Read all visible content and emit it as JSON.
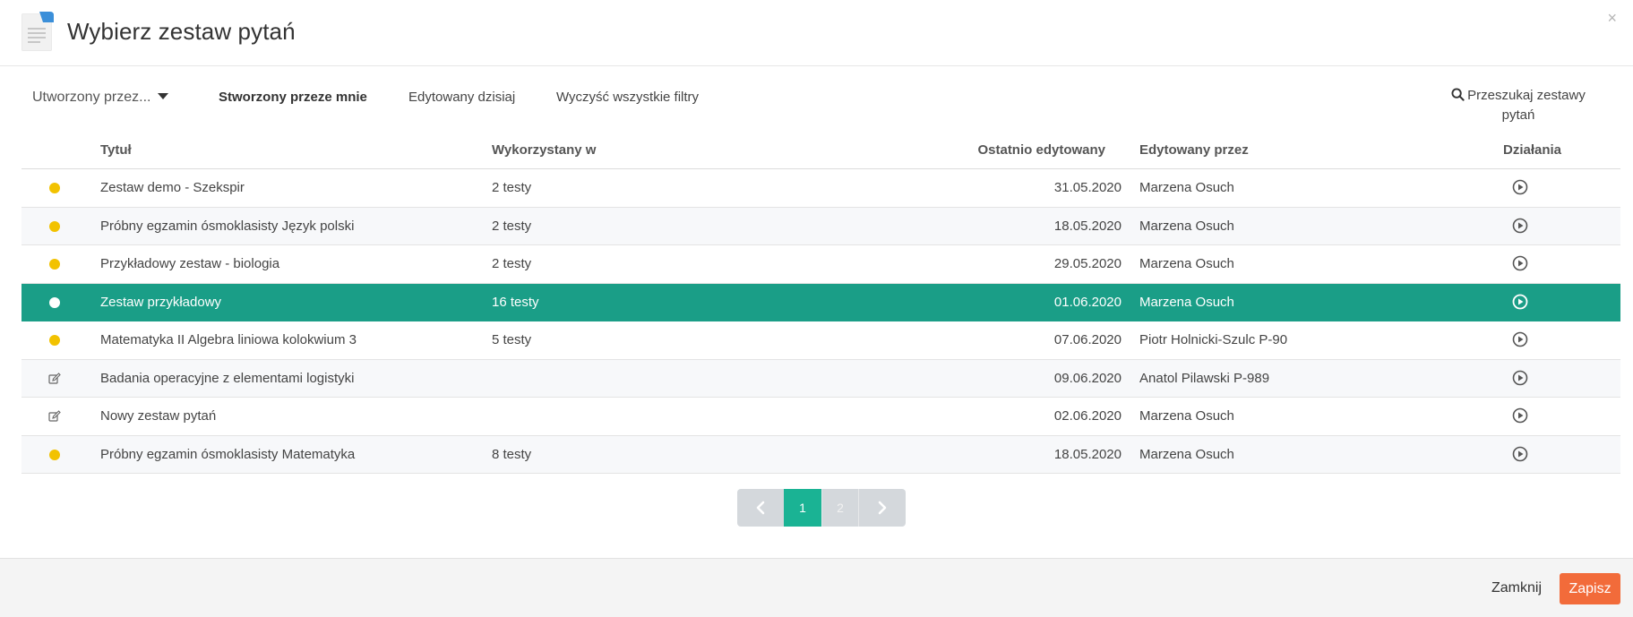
{
  "header": {
    "title": "Wybierz zestaw pytań",
    "close_label": "×",
    "icon": "document-icon"
  },
  "filters": {
    "created_by_dropdown": "Utworzony przez...",
    "created_by_me": "Stworzony przeze mnie",
    "edited_today": "Edytowany dzisiaj",
    "clear_all": "Wyczyść wszystkie filtry",
    "search_line1": "Przeszukaj zestawy",
    "search_line2": "pytań"
  },
  "table": {
    "headers": {
      "title": "Tytuł",
      "used_in": "Wykorzystany w",
      "last_edited": "Ostatnio edytowany",
      "edited_by": "Edytowany przez",
      "actions": "Działania"
    },
    "rows": [
      {
        "status": "dot",
        "title": "Zestaw demo - Szekspir",
        "used_in": "2 testy",
        "date": "31.05.2020",
        "editor": "Marzena Osuch",
        "active": false
      },
      {
        "status": "dot",
        "title": "Próbny egzamin ósmoklasisty Język polski",
        "used_in": "2 testy",
        "date": "18.05.2020",
        "editor": "Marzena Osuch",
        "active": false
      },
      {
        "status": "dot",
        "title": "Przykładowy zestaw - biologia",
        "used_in": "2 testy",
        "date": "29.05.2020",
        "editor": "Marzena Osuch",
        "active": false
      },
      {
        "status": "dot",
        "title": "Zestaw przykładowy",
        "used_in": "16 testy",
        "date": "01.06.2020",
        "editor": "Marzena Osuch",
        "active": true
      },
      {
        "status": "dot",
        "title": "Matematyka II Algebra liniowa kolokwium 3",
        "used_in": "5 testy",
        "date": "07.06.2020",
        "editor": "Piotr Holnicki-Szulc P-90",
        "active": false
      },
      {
        "status": "edit",
        "title": "Badania operacyjne z elementami logistyki",
        "used_in": "",
        "date": "09.06.2020",
        "editor": "Anatol Pilawski P-989",
        "active": false
      },
      {
        "status": "edit",
        "title": "Nowy zestaw pytań",
        "used_in": "",
        "date": "02.06.2020",
        "editor": "Marzena Osuch",
        "active": false
      },
      {
        "status": "dot",
        "title": "Próbny egzamin ósmoklasisty Matematyka",
        "used_in": "8 testy",
        "date": "18.05.2020",
        "editor": "Marzena Osuch",
        "active": false
      }
    ]
  },
  "pagination": {
    "pages": [
      "1",
      "2"
    ],
    "current": "1"
  },
  "footer": {
    "close_label": "Zamknij",
    "save_label": "Zapisz"
  },
  "colors": {
    "accent": "#1a9e87",
    "status_dot": "#f2c200",
    "save_button": "#f26b3a",
    "page_current": "#1ab394"
  }
}
